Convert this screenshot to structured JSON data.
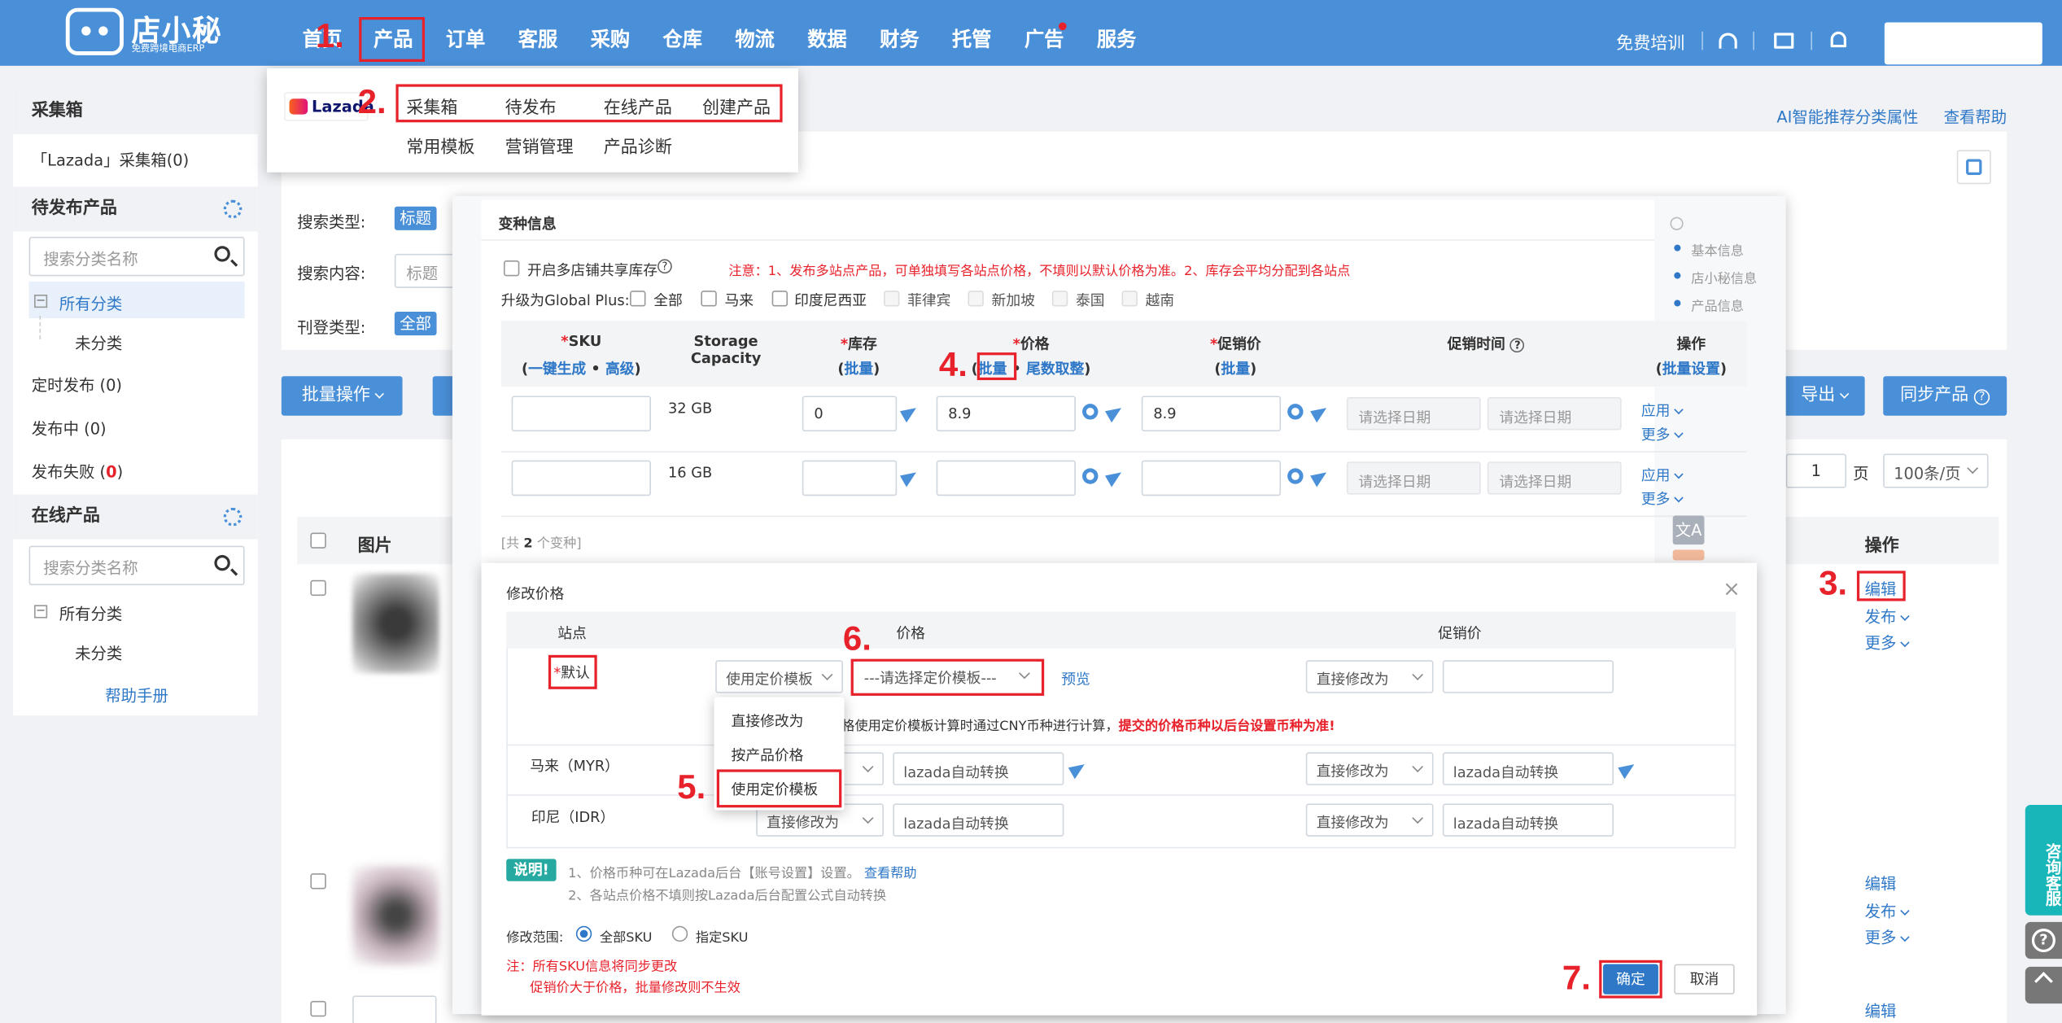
{
  "nav": {
    "logo_name": "店小秘",
    "logo_sub": "免费跨境电商ERP",
    "items": [
      "首页",
      "产品",
      "订单",
      "客服",
      "采购",
      "仓库",
      "物流",
      "数据",
      "财务",
      "托管",
      "广告",
      "服务"
    ],
    "free_training": "免费培训"
  },
  "steps": [
    "1.",
    "2.",
    "3.",
    "4.",
    "5.",
    "6.",
    "7."
  ],
  "product_menu": {
    "brand": "Lazada",
    "row1": [
      "采集箱",
      "待发布",
      "在线产品",
      "创建产品"
    ],
    "row2": [
      "常用模板",
      "营销管理",
      "产品诊断"
    ]
  },
  "sidebar": {
    "collect_title": "采集箱",
    "collect_item": "「Lazada」采集箱(0)",
    "pending_title": "待发布产品",
    "search_placeholder": "搜索分类名称",
    "all_category": "所有分类",
    "uncategorized": "未分类",
    "timed": "定时发布 (0)",
    "publishing": "发布中 (0)",
    "failed_prefix": "发布失败 (",
    "failed_count": "0",
    "failed_suffix": ")",
    "online_title": "在线产品",
    "online_search_placeholder": "搜索分类名称",
    "online_all": "所有分类",
    "online_uncat": "未分类",
    "help": "帮助手册"
  },
  "main": {
    "ai_link": "AI智能推荐分类属性",
    "help_link": "查看帮助",
    "search_type_label": "搜索类型:",
    "search_type_value": "标题",
    "search_content_label": "搜索内容:",
    "search_content_value": "标题",
    "listing_type_label": "刊登类型:",
    "listing_type_value": "全部",
    "batch_btn": "批量操作",
    "export_btn": "导出",
    "sync_btn": "同步产品",
    "page_num": "1",
    "page_label": "页",
    "per_page": "100条/页",
    "col_image": "图片",
    "col_ops": "操作",
    "edit": "编辑",
    "publish": "发布",
    "more": "更多"
  },
  "variant": {
    "title": "变种信息",
    "multi_store": "开启多店铺共享库存",
    "notice": "注意：1、发布多站点产品，可单独填写各站点价格，不填则以默认价格为准。2、库存会平均分配到各站点",
    "upgrade_label": "升级为Global Plus:",
    "regions": [
      "全部",
      "马来",
      "印度尼西亚",
      "菲律宾",
      "新加坡",
      "泰国",
      "越南"
    ],
    "th_sku": "SKU",
    "th_sku_gen": "一键生成",
    "th_sku_adv": "高级",
    "th_capacity": "Storage Capacity",
    "th_stock": "库存",
    "th_batch": "批量",
    "th_price": "价格",
    "th_price_batch": "批量",
    "th_round": "尾数取整",
    "th_promo": "促销价",
    "th_promo_time": "促销时间",
    "th_ops": "操作",
    "th_ops_batch": "批量设置",
    "rows": [
      {
        "capacity": "32 GB",
        "stock": "0",
        "price": "8.9",
        "promo": "8.9"
      },
      {
        "capacity": "16 GB",
        "stock": "",
        "price": "",
        "promo": ""
      }
    ],
    "date_placeholder": "请选择日期",
    "apply": "应用",
    "more": "更多",
    "total_prefix": "[共",
    "total_count": "2",
    "total_suffix": "个变种]",
    "toc": [
      "基本信息",
      "店小秘信息",
      "产品信息"
    ]
  },
  "modal": {
    "title": "修改价格",
    "col_site": "站点",
    "col_price": "价格",
    "col_promo": "促销价",
    "default_site": "默认",
    "price_mode": "使用定价模板",
    "template_select": "---请选择定价模板---",
    "preview": "预览",
    "promo_mode": "直接修改为",
    "dropdown_options": [
      "直接修改为",
      "按产品价格",
      "使用定价模板"
    ],
    "hint_black": "认价格使用定价模板计算时通过CNY币种进行计算，",
    "hint_red": "提交的价格币种以后台设置币种为准!",
    "rows": [
      {
        "site": "马来（MYR）",
        "mode": "",
        "value": "lazada自动转换",
        "promo_mode": "直接修改为",
        "promo_value": "lazada自动转换"
      },
      {
        "site": "印尼（IDR）",
        "mode": "直接修改为",
        "value": "lazada自动转换",
        "promo_mode": "直接修改为",
        "promo_value": "lazada自动转换"
      }
    ],
    "note_tag": "说明!",
    "note1": "1、价格币种可在Lazada后台【账号设置】设置。",
    "note1_link": "查看帮助",
    "note2": "2、各站点价格不填则按Lazada后台配置公式自动转换",
    "scope_label": "修改范围:",
    "scope_all": "全部SKU",
    "scope_some": "指定SKU",
    "warn1": "注：所有SKU信息将同步更改",
    "warn2": "促销价大于价格，批量修改则不生效",
    "ok": "确定",
    "cancel": "取消"
  },
  "float": {
    "consult": "咨询客服"
  }
}
